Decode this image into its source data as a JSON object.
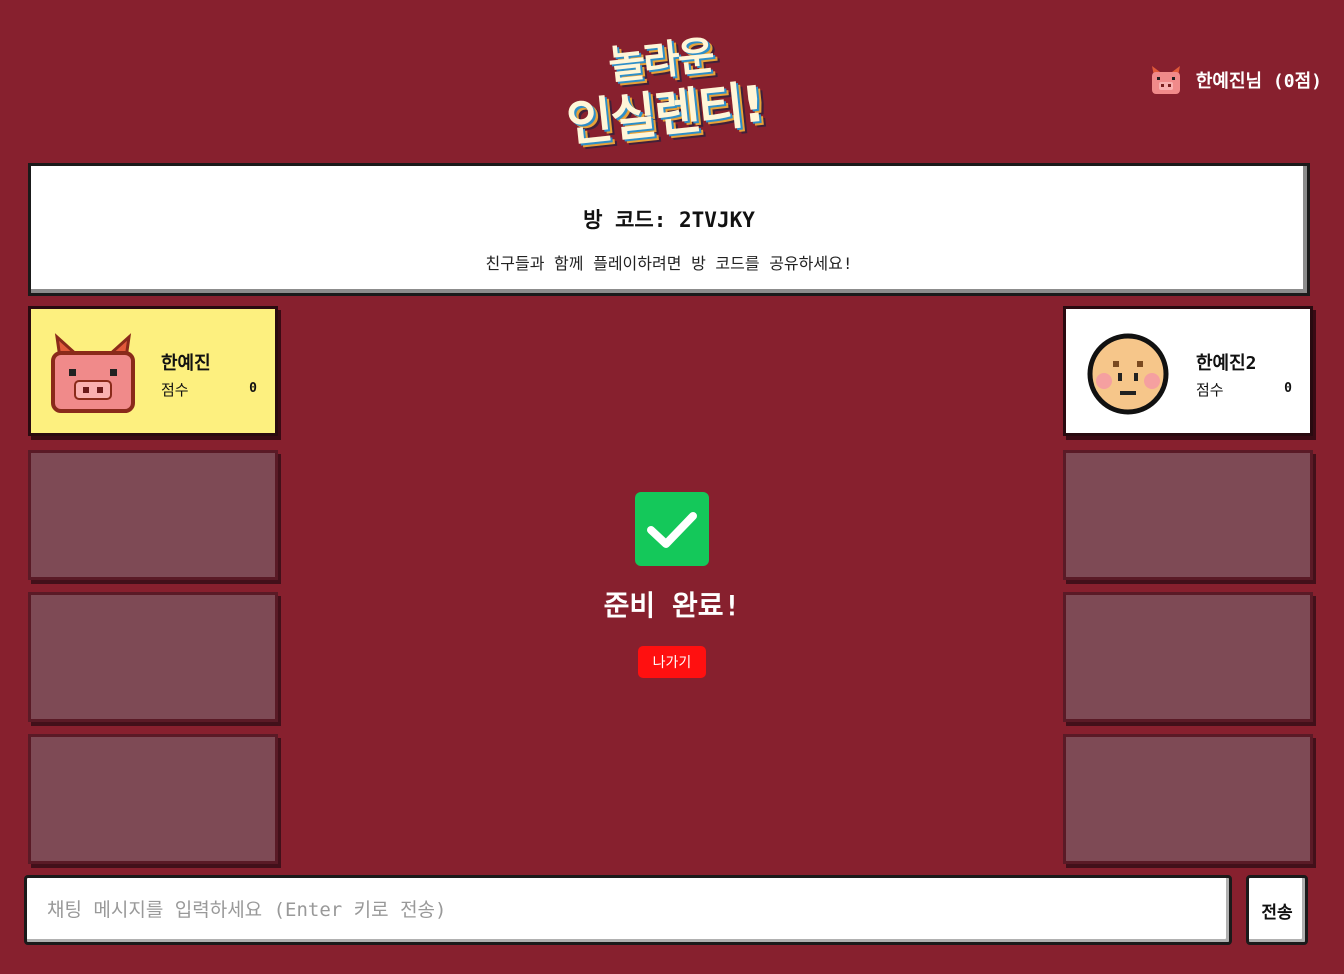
{
  "logo": {
    "line1": "놀라운",
    "line2": "인실렌티!"
  },
  "user": {
    "name_label": "한예진님 (0점)",
    "avatar_icon": "pig-avatar-icon"
  },
  "room": {
    "code_label": "방 코드: 2TVJKY",
    "hint": "친구들과 함께 플레이하려면 방 코드를 공유하세요!"
  },
  "players": [
    {
      "name": "한예진",
      "score_label": "점수",
      "score": "0",
      "avatar_icon": "pig-avatar-icon",
      "highlight": "#fdf07f"
    },
    {
      "name": "한예진2",
      "score_label": "점수",
      "score": "0",
      "avatar_icon": "face-avatar-icon",
      "highlight": "#ffffff"
    }
  ],
  "status": {
    "ready_text": "준비 완료!",
    "check_color": "#14c85a"
  },
  "actions": {
    "leave_label": "나가기"
  },
  "chat": {
    "placeholder": "채팅 메시지를 입력하세요 (Enter 키로 전송)",
    "value": "",
    "send_label": "전송"
  },
  "colors": {
    "background": "#87202e",
    "empty_slot": "#7e4a55",
    "leave_button": "#ff1010"
  }
}
